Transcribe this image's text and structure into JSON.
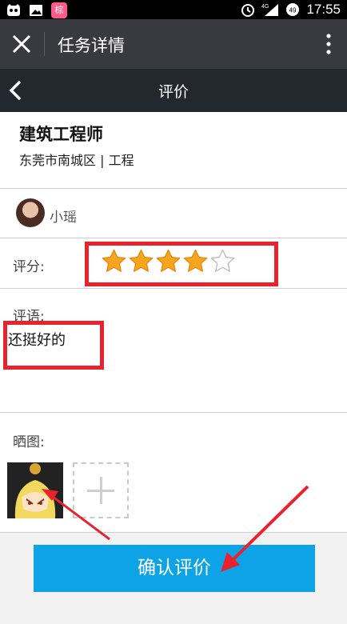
{
  "status_bar": {
    "app_badge": "棕",
    "network": "4G",
    "battery_level": "49",
    "time": "17:55"
  },
  "wechat_bar": {
    "title": "任务详情"
  },
  "nav": {
    "title": "评价"
  },
  "task": {
    "title": "建筑工程师",
    "meta": "东莞市南城区 |  工程"
  },
  "user": {
    "name": "小瑶"
  },
  "rating": {
    "label": "评分:",
    "value": 4,
    "max": 5,
    "filled_color": "#f7a51f",
    "empty_color": "#e0e0e0"
  },
  "comment": {
    "label": "评语:",
    "text": "还挺好的"
  },
  "photos": {
    "label": "晒图:"
  },
  "submit": {
    "label": "确认评价"
  },
  "colors": {
    "accent": "#0ea3e6",
    "annotation": "#e8232d"
  }
}
